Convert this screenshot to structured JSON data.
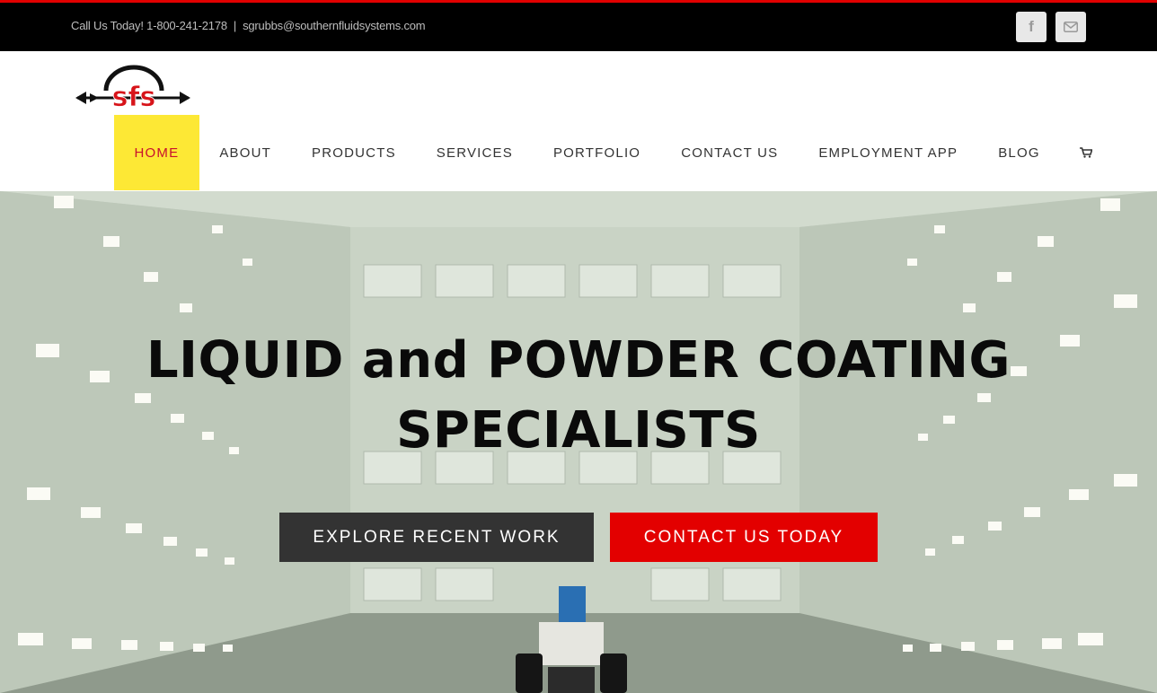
{
  "topbar": {
    "phone": "Call Us Today! 1-800-241-2178",
    "separator": "|",
    "email": "sgrubbs@southernfluidsystems.com",
    "facebook_icon": "f"
  },
  "logo": {
    "text": "sfs"
  },
  "nav": {
    "items": [
      {
        "label": "HOME",
        "active": true
      },
      {
        "label": "ABOUT"
      },
      {
        "label": "PRODUCTS"
      },
      {
        "label": "SERVICES"
      },
      {
        "label": "PORTFOLIO"
      },
      {
        "label": "CONTACT US"
      },
      {
        "label": "EMPLOYMENT APP"
      },
      {
        "label": "BLOG"
      }
    ],
    "cart_icon": "cart-icon"
  },
  "hero": {
    "headline_line1": "LIQUID and POWDER COATING",
    "headline_line2": "SPECIALISTS",
    "btn_explore": "EXPLORE RECENT WORK",
    "btn_contact": "CONTACT US TODAY"
  },
  "colors": {
    "accent_red": "#e30000",
    "nav_active_bg": "#fde835",
    "nav_active_text": "#c8102e",
    "topbar_bg": "#000000",
    "dark_button": "#333333"
  }
}
